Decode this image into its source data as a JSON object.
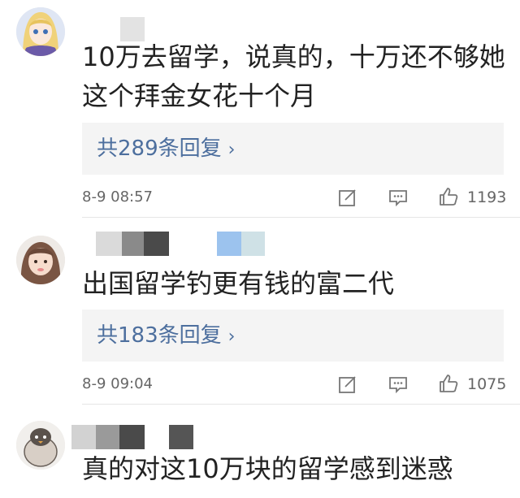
{
  "comments": [
    {
      "text": "10万去留学，说真的，十万还不够她这个拜金女花十个月",
      "replies": "共289条回复",
      "time": "8-9 08:57",
      "likes": "1193"
    },
    {
      "text": "出国留学钓更有钱的富二代",
      "replies": "共183条回复",
      "time": "8-9 09:04",
      "likes": "1075"
    },
    {
      "text": "真的对这10万块的留学感到迷惑"
    }
  ],
  "icons": {
    "chevron": "chevron-right-icon",
    "edit": "edit-icon",
    "reply": "comment-icon",
    "like": "thumbs-up-icon"
  },
  "colors": {
    "link": "#4d6f9e",
    "text": "#222222",
    "meta": "#666666",
    "reply_bg": "#f4f4f4"
  }
}
